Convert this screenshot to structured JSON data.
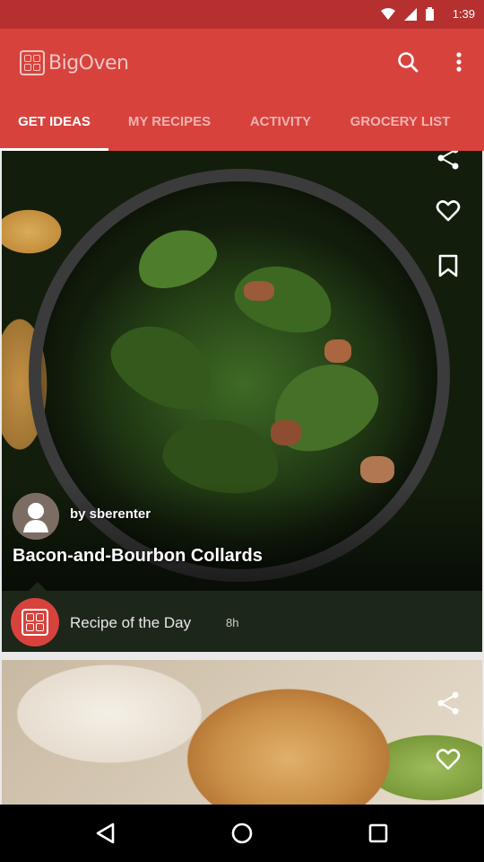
{
  "status_bar": {
    "time": "1:39"
  },
  "app": {
    "logo_text": "BigOven"
  },
  "tabs": [
    {
      "label": "GET IDEAS",
      "active": true
    },
    {
      "label": "MY RECIPES",
      "active": false
    },
    {
      "label": "ACTIVITY",
      "active": false
    },
    {
      "label": "GROCERY LIST",
      "active": false
    }
  ],
  "feed": {
    "card1": {
      "author": "by sberenter",
      "title": "Bacon-and-Bourbon Collards",
      "footer_label": "Recipe of the Day",
      "footer_time": "8h"
    }
  },
  "colors": {
    "app_bar": "#d8423d",
    "status_bar": "#b5302f",
    "card_footer": "#1c2619"
  },
  "icons": [
    "search-icon",
    "more-vert-icon",
    "share-icon",
    "heart-icon",
    "bookmark-icon",
    "user-avatar-icon",
    "bigoven-logo-icon",
    "back-icon",
    "home-icon",
    "recents-icon"
  ]
}
